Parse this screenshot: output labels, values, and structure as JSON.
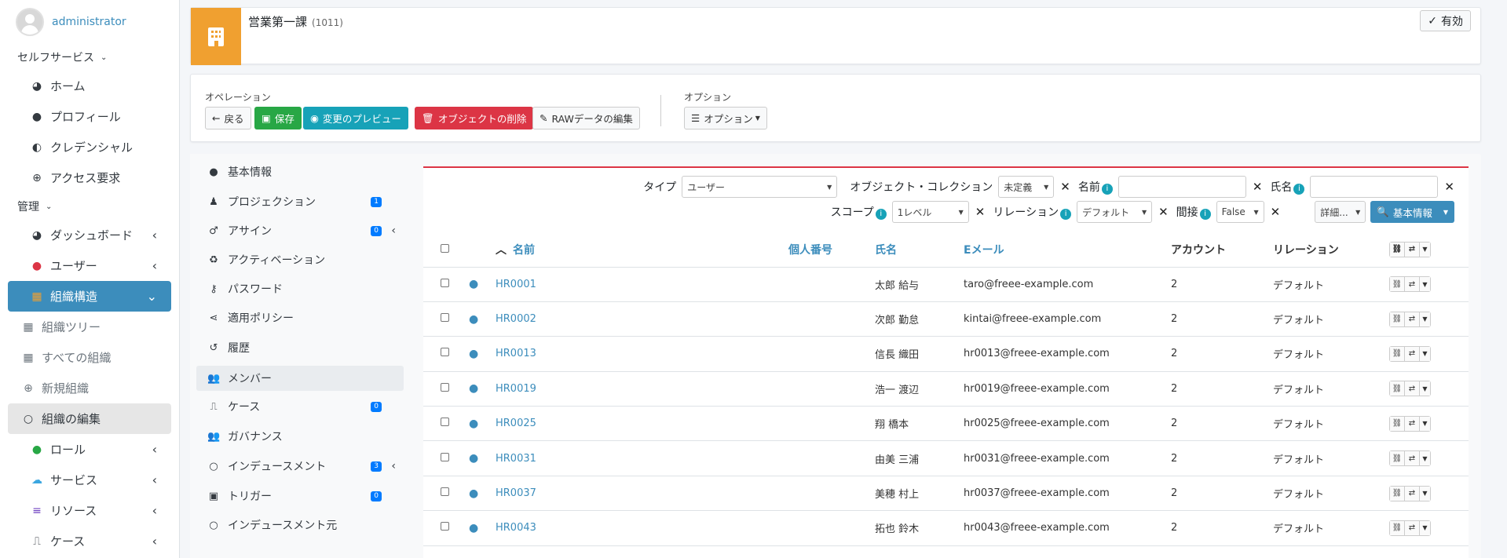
{
  "sidebar": {
    "user_name": "administrator",
    "selfservice_header": "セルフサービス",
    "selfservice_items": [
      {
        "label": "ホーム",
        "icon": "palette-icon"
      },
      {
        "label": "プロフィール",
        "icon": "person-icon"
      },
      {
        "label": "クレデンシャル",
        "icon": "shield-icon"
      },
      {
        "label": "アクセス要求",
        "icon": "plus-circle-icon"
      }
    ],
    "admin_header": "管理",
    "admin_items": [
      {
        "label": "ダッシュボード"
      },
      {
        "label": "ユーザー"
      },
      {
        "label": "組織構造"
      },
      {
        "label": "組織ツリー"
      },
      {
        "label": "すべての組織"
      },
      {
        "label": "新規組織"
      },
      {
        "label": "組織の編集"
      },
      {
        "label": "ロール"
      },
      {
        "label": "サービス"
      },
      {
        "label": "リソース"
      },
      {
        "label": "ケース"
      }
    ]
  },
  "header": {
    "org_name": "営業第一課",
    "org_code": "(1011)",
    "status": "有効"
  },
  "operations": {
    "label": "オペレーション",
    "back": "戻る",
    "save": "保存",
    "preview": "変更のプレビュー",
    "delete": "オブジェクトの削除",
    "raw_edit": "RAWデータの編集",
    "options_label": "オプション",
    "options_button": "オプション"
  },
  "tabs": [
    {
      "label": "基本情報"
    },
    {
      "label": "プロジェクション",
      "badge": "1"
    },
    {
      "label": "アサイン",
      "badge": "0"
    },
    {
      "label": "アクティベーション"
    },
    {
      "label": "パスワード"
    },
    {
      "label": "適用ポリシー"
    },
    {
      "label": "履歴"
    },
    {
      "label": "メンバー"
    },
    {
      "label": "ケース",
      "badge": "0"
    },
    {
      "label": "ガバナンス"
    },
    {
      "label": "インデュースメント",
      "badge": "3"
    },
    {
      "label": "トリガー",
      "badge": "0"
    },
    {
      "label": "インデュースメント元"
    }
  ],
  "filters": {
    "type_label": "タイプ",
    "type_value": "ユーザー",
    "collection_label": "オブジェクト・コレクション",
    "collection_value": "未定義",
    "name_label": "名前",
    "fullname_label": "氏名",
    "scope_label": "スコープ",
    "scope_value": "1レベル",
    "relation_label": "リレーション",
    "relation_value": "デフォルト",
    "indirect_label": "間接",
    "indirect_value": "False",
    "more": "詳細...",
    "search": "基本情報"
  },
  "table": {
    "headers": {
      "name": "名前",
      "personal_number": "個人番号",
      "full_name": "氏名",
      "email": "Eメール",
      "account": "アカウント",
      "relation": "リレーション"
    },
    "rows": [
      {
        "name": "HR0001",
        "full_name": "太郎 給与",
        "email": "taro@freee-example.com",
        "account": "2",
        "relation": "デフォルト"
      },
      {
        "name": "HR0002",
        "full_name": "次郎 勤怠",
        "email": "kintai@freee-example.com",
        "account": "2",
        "relation": "デフォルト"
      },
      {
        "name": "HR0013",
        "full_name": "信長 織田",
        "email": "hr0013@freee-example.com",
        "account": "2",
        "relation": "デフォルト"
      },
      {
        "name": "HR0019",
        "full_name": "浩一 渡辺",
        "email": "hr0019@freee-example.com",
        "account": "2",
        "relation": "デフォルト"
      },
      {
        "name": "HR0025",
        "full_name": "翔 橋本",
        "email": "hr0025@freee-example.com",
        "account": "2",
        "relation": "デフォルト"
      },
      {
        "name": "HR0031",
        "full_name": "由美 三浦",
        "email": "hr0031@freee-example.com",
        "account": "2",
        "relation": "デフォルト"
      },
      {
        "name": "HR0037",
        "full_name": "美穂 村上",
        "email": "hr0037@freee-example.com",
        "account": "2",
        "relation": "デフォルト"
      },
      {
        "name": "HR0043",
        "full_name": "拓也 鈴木",
        "email": "hr0043@freee-example.com",
        "account": "2",
        "relation": "デフォルト"
      }
    ]
  },
  "colors": {
    "accent": "#3c8dbc",
    "org_icon": "#f0a030",
    "danger": "#dc3545"
  }
}
